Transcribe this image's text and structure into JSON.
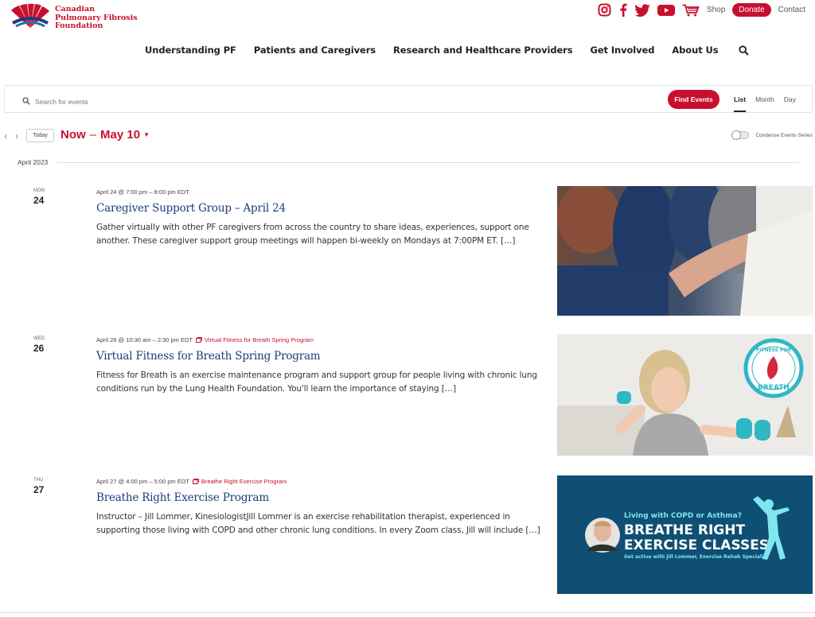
{
  "org": {
    "name_lines": [
      "Canadian",
      "Pulmonary Fibrosis",
      "Foundation"
    ],
    "brand_color": "#c8102e"
  },
  "utility": {
    "shop": "Shop",
    "donate": "Donate",
    "contact": "Contact"
  },
  "nav": [
    "Understanding PF",
    "Patients and Caregivers",
    "Research and Healthcare Providers",
    "Get Involved",
    "About Us"
  ],
  "event_search": {
    "placeholder": "Search for events",
    "find_button": "Find Events",
    "views": [
      "List",
      "Month",
      "Day"
    ],
    "active_view": "List"
  },
  "date_nav": {
    "today": "Today",
    "range_start": "Now",
    "range_sep": "–",
    "range_end": "May 10",
    "condense_label": "Condense Events Series"
  },
  "month_label": "April 2023",
  "events": [
    {
      "dow": "MON",
      "day": "24",
      "datetime": "April 24 @ 7:00 pm – 8:00 pm EDT",
      "series": "",
      "title": "Caregiver Support Group – April 24",
      "description": "Gather virtually with other PF caregivers from across the country to share ideas, experiences, support one another. These caregiver support group meetings will happen bi-weekly on Mondays at 7:00PM ET. […]"
    },
    {
      "dow": "WED",
      "day": "26",
      "datetime": "April 26 @ 10:30 am – 2:30 pm EDT",
      "series": "Virtual Fitness for Breath Spring Program",
      "title": "Virtual Fitness for Breath Spring Program",
      "description": "Fitness for Breath is an exercise maintenance program and support group for people living with chronic lung conditions run by the Lung Health Foundation. You'll learn the importance of staying […]",
      "badge_top": "FITNESS FOR",
      "badge_bottom": "BREATH"
    },
    {
      "dow": "THU",
      "day": "27",
      "datetime": "April 27 @ 4:00 pm – 5:00 pm EDT",
      "series": "Breathe Right Exercise Program",
      "title": "Breathe Right Exercise Program",
      "description": "Instructor – Jill Lommer, KinesiologistJill Lommer is an exercise rehabilitation therapist, experienced in supporting those living with COPD and other chronic lung conditions. In every Zoom class, Jill will include […]",
      "promo": {
        "line1": "Living with COPD or Asthma?",
        "line2": "BREATHE RIGHT",
        "line3": "EXERCISE CLASSES",
        "line4": "Get active with Jill Lommer, Exercise Rehab Specialist"
      }
    }
  ]
}
